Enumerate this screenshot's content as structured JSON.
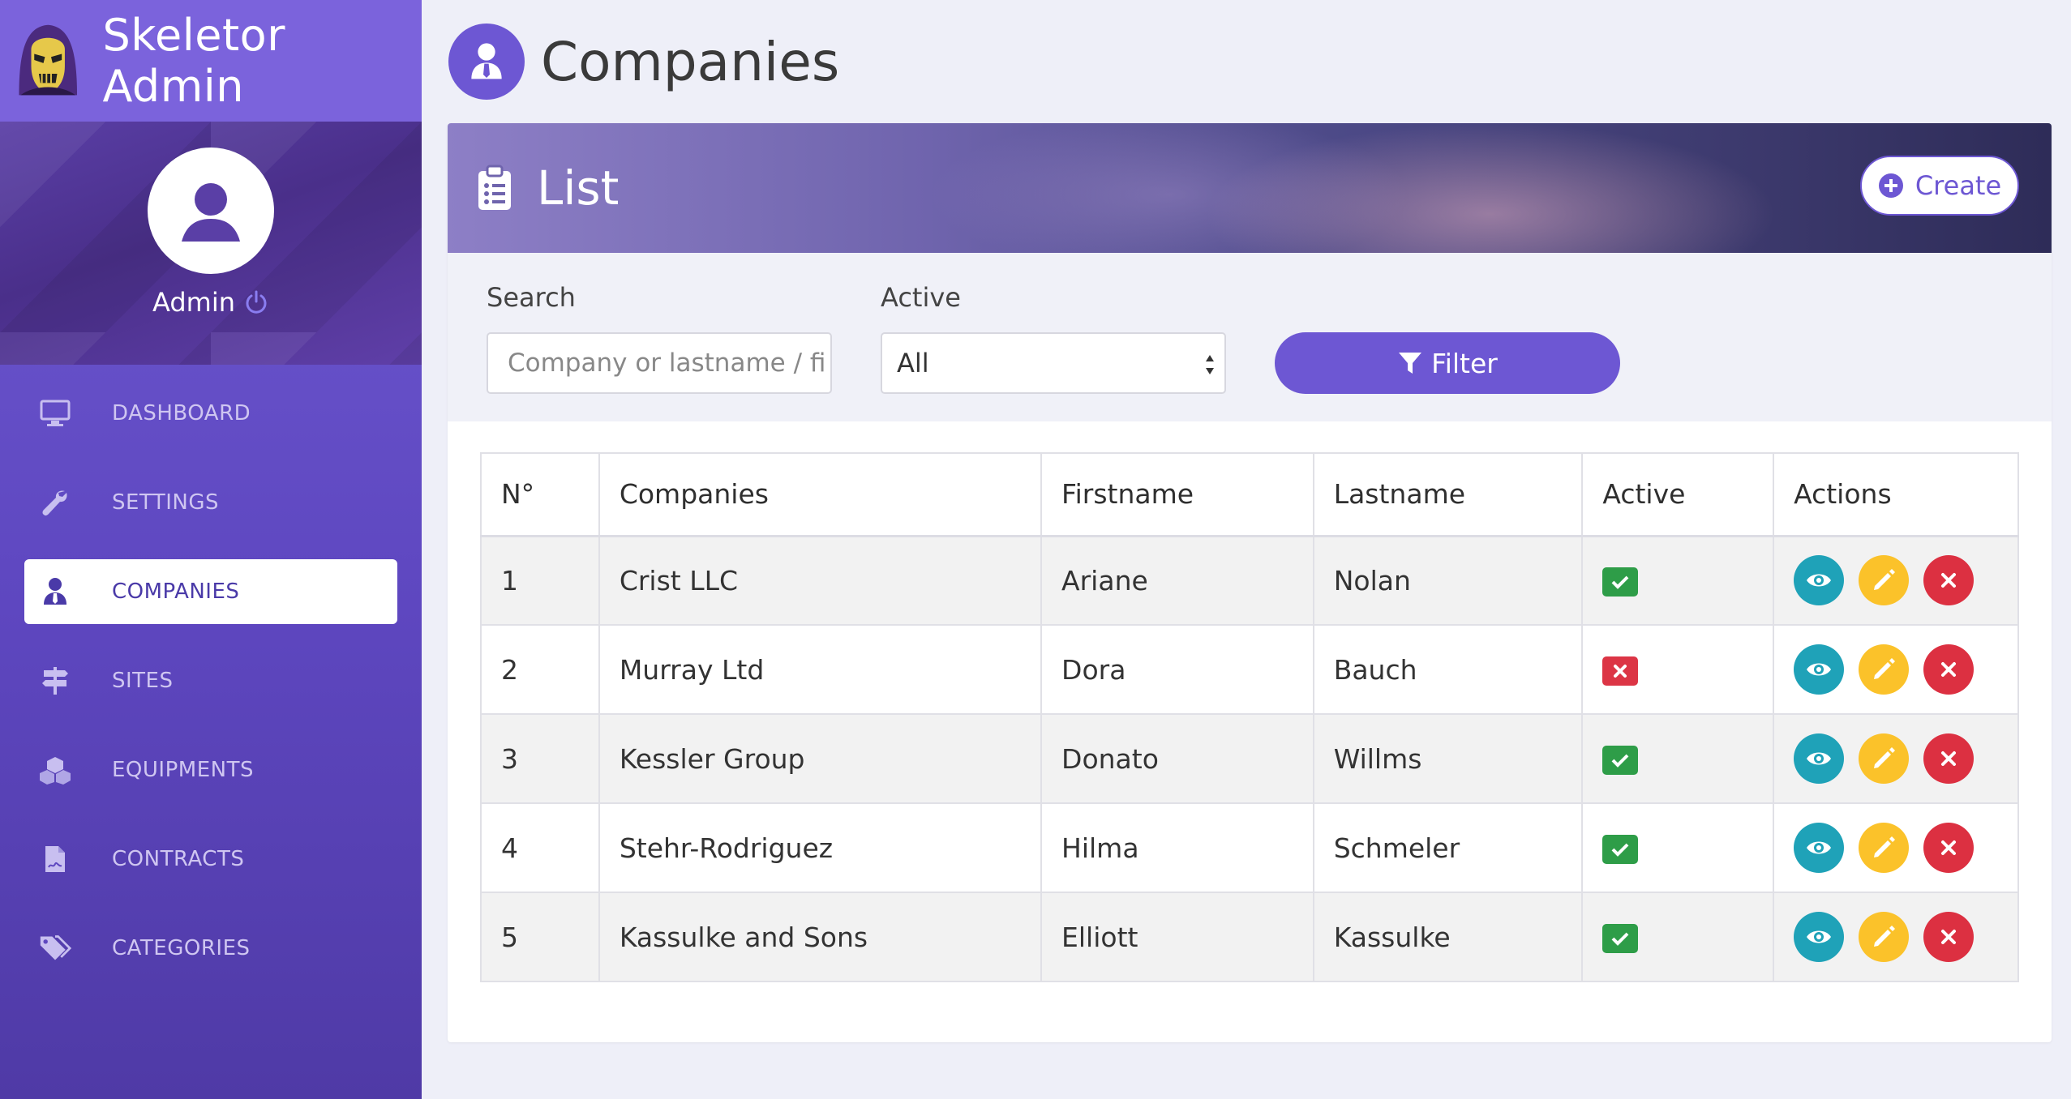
{
  "brand": {
    "name": "Skeletor Admin"
  },
  "user": {
    "name": "Admin"
  },
  "nav": [
    {
      "label": "DASHBOARD",
      "icon": "monitor-icon",
      "active": false
    },
    {
      "label": "SETTINGS",
      "icon": "wrench-icon",
      "active": false
    },
    {
      "label": "COMPANIES",
      "icon": "user-tie-icon",
      "active": true
    },
    {
      "label": "SITES",
      "icon": "signpost-icon",
      "active": false
    },
    {
      "label": "EQUIPMENTS",
      "icon": "cubes-icon",
      "active": false
    },
    {
      "label": "CONTRACTS",
      "icon": "file-contract-icon",
      "active": false
    },
    {
      "label": "CATEGORIES",
      "icon": "tags-icon",
      "active": false
    }
  ],
  "page": {
    "title": "Companies"
  },
  "card": {
    "title": "List",
    "create_label": "Create"
  },
  "filters": {
    "search_label": "Search",
    "search_placeholder": "Company or lastname / fi",
    "active_label": "Active",
    "active_value": "All",
    "filter_label": "Filter"
  },
  "table": {
    "headers": [
      "N°",
      "Companies",
      "Firstname",
      "Lastname",
      "Active",
      "Actions"
    ],
    "rows": [
      {
        "no": "1",
        "company": "Crist LLC",
        "firstname": "Ariane",
        "lastname": "Nolan",
        "active": true
      },
      {
        "no": "2",
        "company": "Murray Ltd",
        "firstname": "Dora",
        "lastname": "Bauch",
        "active": false
      },
      {
        "no": "3",
        "company": "Kessler Group",
        "firstname": "Donato",
        "lastname": "Willms",
        "active": true
      },
      {
        "no": "4",
        "company": "Stehr-Rodriguez",
        "firstname": "Hilma",
        "lastname": "Schmeler",
        "active": true
      },
      {
        "no": "5",
        "company": "Kassulke and Sons",
        "firstname": "Elliott",
        "lastname": "Kassulke",
        "active": true
      }
    ]
  },
  "colors": {
    "accent": "#6d57d3",
    "active_badge": "#2e9d48",
    "inactive_badge": "#dc3545",
    "view": "#1fa2b8",
    "edit": "#fbc22a",
    "delete": "#dc3041"
  }
}
